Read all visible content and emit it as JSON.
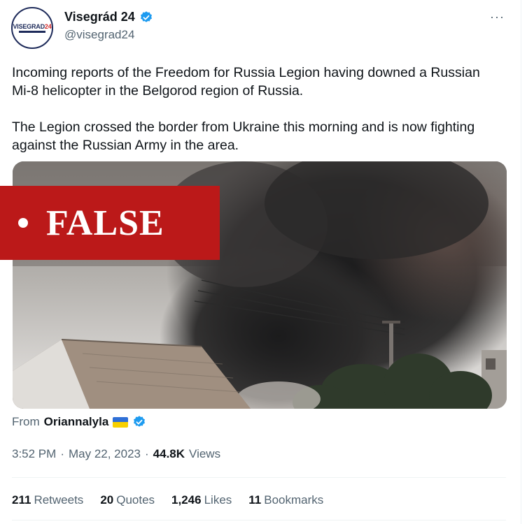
{
  "author": {
    "avatar_text": "VISEGRAD",
    "avatar_number": "24",
    "name": "Visegrád 24",
    "handle": "@visegrad24"
  },
  "more_menu": "···",
  "tweet": {
    "paragraph_1": "Incoming reports of the Freedom for Russia Legion having downed a Russian Mi-8 helicopter in the Belgorod region of Russia.",
    "paragraph_2": "The Legion crossed the border from Ukraine this morning and is now fighting against the Russian Army in the area."
  },
  "overlay_label": "FALSE",
  "media_from": {
    "prefix": "From",
    "user": "Oriannalyla"
  },
  "meta": {
    "time": "3:52 PM",
    "separator": "·",
    "date": "May 22, 2023",
    "views_count": "44.8K",
    "views_label": "Views"
  },
  "stats": [
    {
      "count": "211",
      "label": "Retweets"
    },
    {
      "count": "20",
      "label": "Quotes"
    },
    {
      "count": "1,246",
      "label": "Likes"
    },
    {
      "count": "11",
      "label": "Bookmarks"
    }
  ],
  "colors": {
    "verified_blue": "#1d9bf0",
    "false_banner_red": "#bb1919",
    "secondary_text": "#536471"
  },
  "icons": {
    "verified": "verified-badge-icon",
    "more": "more-icon",
    "flag": "ukraine-flag-icon"
  }
}
